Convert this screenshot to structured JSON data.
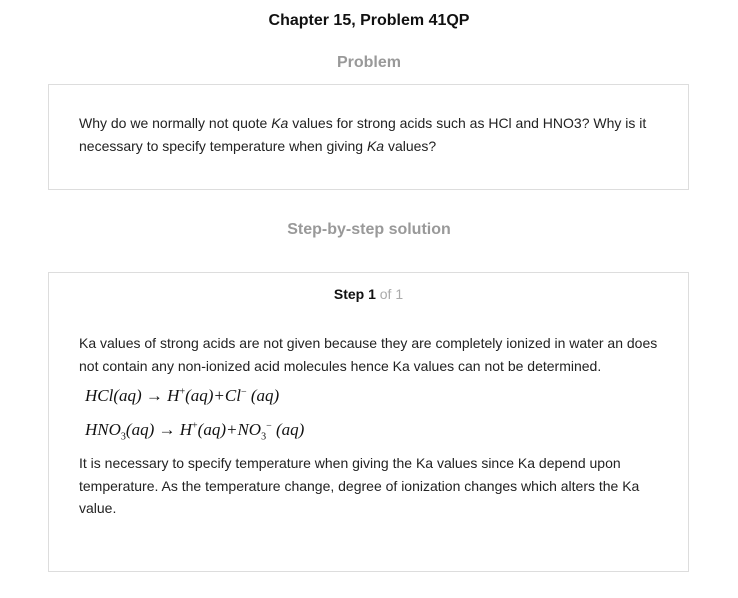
{
  "page": {
    "title": "Chapter 15, Problem 41QP"
  },
  "problem": {
    "heading": "Problem",
    "text_parts": [
      "Why do we normally not quote ",
      "Ka",
      " values for strong acids such as HCl and HNO3? Why is it necessary to specify temperature when giving ",
      "Ka",
      " values?"
    ]
  },
  "solution": {
    "heading": "Step-by-step solution",
    "step_word": "Step 1",
    "step_of": " of 1",
    "paragraph_1": "Ka values of strong acids are not given because they are completely ionized in water an does not contain any non-ionized acid molecules hence Ka values can not be determined.",
    "equation_1": {
      "reactant": "HCl",
      "reactant_state": "(aq)",
      "arrow": "→",
      "cation": "H",
      "cation_charge": "+",
      "cation_state": "(aq)",
      "plus": "+",
      "anion": "Cl",
      "anion_charge": "−",
      "anion_state": "(aq)"
    },
    "equation_2": {
      "reactant": "HNO",
      "reactant_sub": "3",
      "reactant_state": "(aq)",
      "arrow": "→",
      "cation": "H",
      "cation_charge": "+",
      "cation_state": "(aq)",
      "plus": "+",
      "anion": "NO",
      "anion_sub": "3",
      "anion_charge": "−",
      "anion_state": "(aq)"
    },
    "paragraph_2": "It is necessary to specify temperature when giving the Ka values since Ka depend upon temperature. As the temperature change, degree of ionization changes which alters the Ka value."
  }
}
